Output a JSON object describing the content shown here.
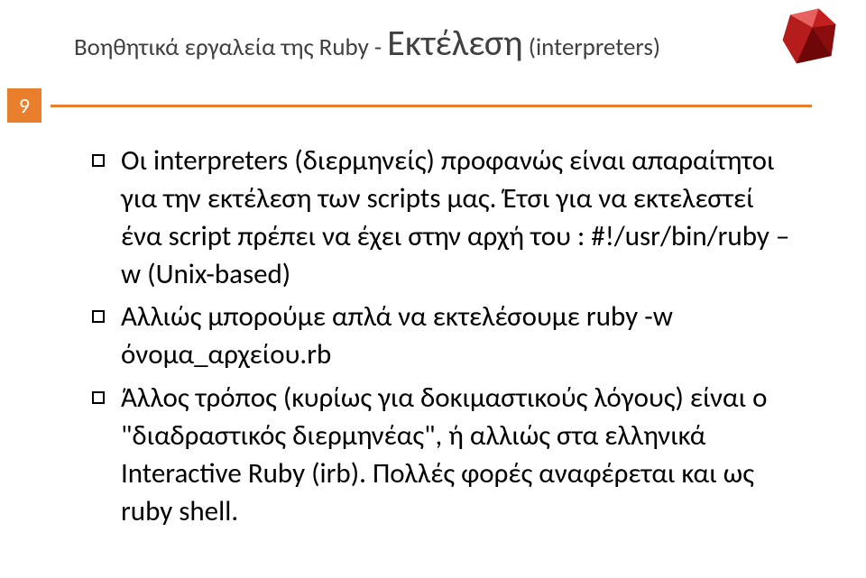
{
  "title": {
    "prefix": "Βοηθητικά εργαλεία της Ruby - ",
    "main": "Εκτέλεση",
    "suffix": " (interpreters)"
  },
  "page_number": "9",
  "bullets": [
    "Οι interpreters (διερμηνείς) προφανώς είναι απαραίτητοι για την εκτέλεση των scripts μας. Έτσι για να εκτελεστεί ένα script πρέπει να έχει στην αρχή του  : #!/usr/bin/ruby –w (Unix-based)",
    "Αλλιώς μπορούμε απλά να εκτελέσουμε ruby -w όνομα_αρχείου.rb",
    "Άλλος τρόπος (κυρίως για δοκιμαστικούς λόγους) είναι ο \"διαδραστικός διερμηνέας\", ή αλλιώς στα ελληνικά Interactive Ruby (irb). Πολλές φορές αναφέρεται και ως ruby shell."
  ]
}
